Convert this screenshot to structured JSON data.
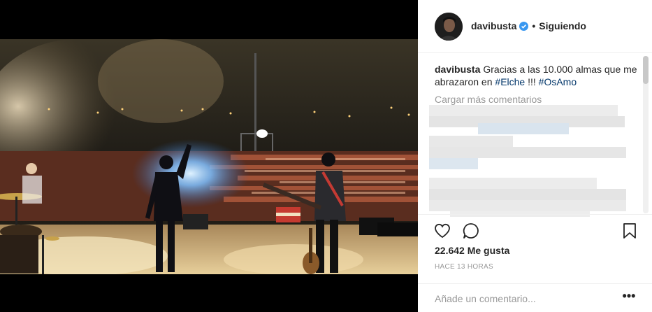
{
  "post": {
    "username": "davibusta",
    "follow_status": "Siguiendo",
    "separator": "•",
    "caption": {
      "username": "davibusta",
      "text": "Gracias a las 10.000 almas que me abrazaron en",
      "hashtag1": "#Elche",
      "mid": " !!! ",
      "hashtag2": "#OsAmo"
    },
    "load_more": "Cargar más comentarios",
    "likes": "22.642 Me gusta",
    "time": "HACE 13 HORAS",
    "comment_placeholder": "Añade un comentario...",
    "more_options": "•••"
  },
  "icons": {
    "verified": "verified-badge-icon",
    "like": "heart-icon",
    "comment": "comment-bubble-icon",
    "save": "bookmark-icon",
    "more": "more-options-icon"
  },
  "colors": {
    "verified": "#3897f0",
    "hashtag": "#003569",
    "muted": "#999999",
    "text": "#262626"
  }
}
